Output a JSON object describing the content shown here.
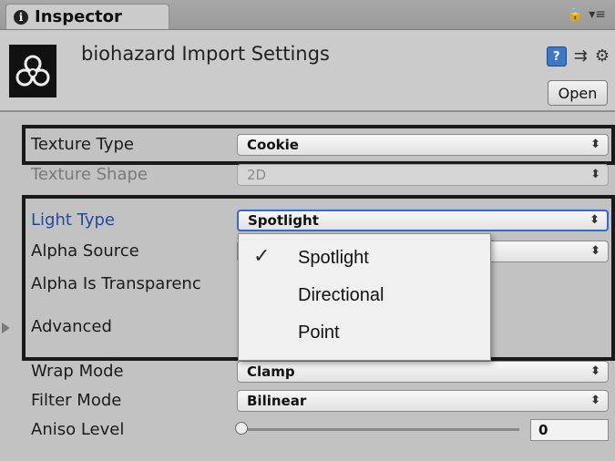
{
  "tab": {
    "title": "Inspector",
    "info_glyph": "❶"
  },
  "header": {
    "title": "biohazard Import Settings",
    "open_label": "Open"
  },
  "fields": {
    "texture_type": {
      "label": "Texture Type",
      "value": "Cookie"
    },
    "texture_shape": {
      "label": "Texture Shape",
      "value": "2D"
    },
    "light_type": {
      "label": "Light Type",
      "value": "Spotlight"
    },
    "alpha_source": {
      "label": "Alpha Source"
    },
    "alpha_is_transparency": {
      "label": "Alpha Is Transparenc"
    },
    "advanced": {
      "label": "Advanced"
    },
    "wrap_mode": {
      "label": "Wrap Mode",
      "value": "Clamp"
    },
    "filter_mode": {
      "label": "Filter Mode",
      "value": "Bilinear"
    },
    "aniso_level": {
      "label": "Aniso Level",
      "value": "0"
    }
  },
  "light_type_popup": {
    "options": [
      "Spotlight",
      "Directional",
      "Point"
    ],
    "selected": "Spotlight"
  },
  "icons": {
    "tab": "info-icon",
    "lock": "lock-icon",
    "menu": "menu-icon",
    "help": "book-icon",
    "presets": "sliders-icon",
    "settings": "gear-icon"
  },
  "colors": {
    "panel": "#c2c2c2",
    "highlight_label": "#1d4c9a",
    "focus_border": "#2f6bd8",
    "group_border": "#1a1a1a"
  }
}
